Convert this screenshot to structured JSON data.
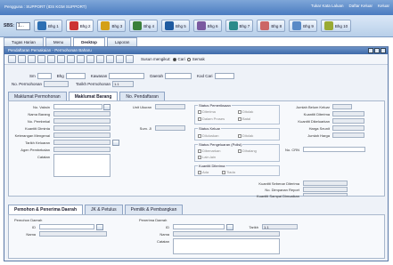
{
  "topbar": {
    "user": "Pengguna : SUPPORT (IDS KGM SUPPORT)",
    "action_1": "Tukar Kata Laluan",
    "action_2": "Daftar Keluar",
    "action_3": "Keluar"
  },
  "shortcuts": {
    "sbs_label": "SBS:",
    "sbs_value": "1...",
    "items": [
      "Bhg 1",
      "Bhg 2",
      "Bhg 3",
      "Bhg 4",
      "Bhg 5",
      "Bhg 6",
      "Bhg 7",
      "Bhg 8",
      "Bhg 9",
      "Bhg 10"
    ]
  },
  "tabs": [
    "Tugas Harian",
    "Menu",
    "Desktop",
    "Laporan"
  ],
  "window": {
    "title": "Pendaftaran Pemakaian - Permohonan Baharu",
    "radio_label": "Susun mengikut:",
    "radio_1": "Cari",
    "radio_2": "Semak"
  },
  "header_fields": {
    "row1": [
      "Sm",
      "Bhg",
      "Kawasan",
      "Daerah",
      "Kod Cari"
    ],
    "no_permohonan": "No. Permohonan",
    "tarikh_permohonan": "Tarikh Permohonan",
    "tarikh_value": "1.1"
  },
  "panel_tabs": [
    "Maklumat Permohonan",
    "Maklumat Barang",
    "No. Pendaftaran"
  ],
  "left_labels": [
    "No. Vaksin",
    "Nama Barang",
    "No. Pembekal",
    "Kuantiti Diminta",
    "Keterangan Mengenai",
    "Tarikh Keluaran",
    "Agen Pembekalan",
    "Catatan"
  ],
  "mid_labels": {
    "unit": "Unit Ukuran",
    "sum": "Sum. Jl"
  },
  "groups": {
    "status_pemeriksaan": "Status Pemeriksaan",
    "status_pemeriksaan_opts": [
      "Diterima",
      "Ditolak",
      "Dalam Proses",
      "Batal"
    ],
    "status_keluar": "Status Keluar",
    "status_keluar_opts": [
      "Diluluskan",
      "Ditolak"
    ],
    "status_pengeluaran": "Status Pengeluaran (Polisi)",
    "status_pengeluaran_opts": [
      "Dibenarkan",
      "Dihalang",
      "Lain-lain"
    ],
    "kuantiti_diterima": "Kuantiti Diterima",
    "kuantiti_diterima_opts": [
      "Ada",
      "Tiada"
    ]
  },
  "right_labels": [
    "Jumlah Belum Keluar",
    "Kuantiti Diterima",
    "Kuantiti Dikeluarkan",
    "Harga Seunit",
    "Jumlah Harga"
  ],
  "no_cr": "No. CRN",
  "kuantiti_labels": [
    "Kuantiti Sebenar Diterima",
    "No. Dimpanan Report",
    "Kuantiti Sampai Dimuaikan"
  ],
  "bottom_tabs": [
    "Pemohon & Penerima Daerah",
    "JK & Petulus",
    "Pemilik & Pembangkan"
  ],
  "bottom_left": {
    "title": "Pemohon Daerah",
    "id": "ID",
    "nama": "Nama"
  },
  "bottom_right": {
    "title": "Penerima Daerah",
    "id": "ID",
    "tarikh": "Tarikh",
    "tarikh_value": "1.1",
    "nama": "Nama",
    "catatan": "Catatan"
  },
  "colors": {
    "accent": "#4a7bc0",
    "window_title": "#3e6aa9"
  }
}
